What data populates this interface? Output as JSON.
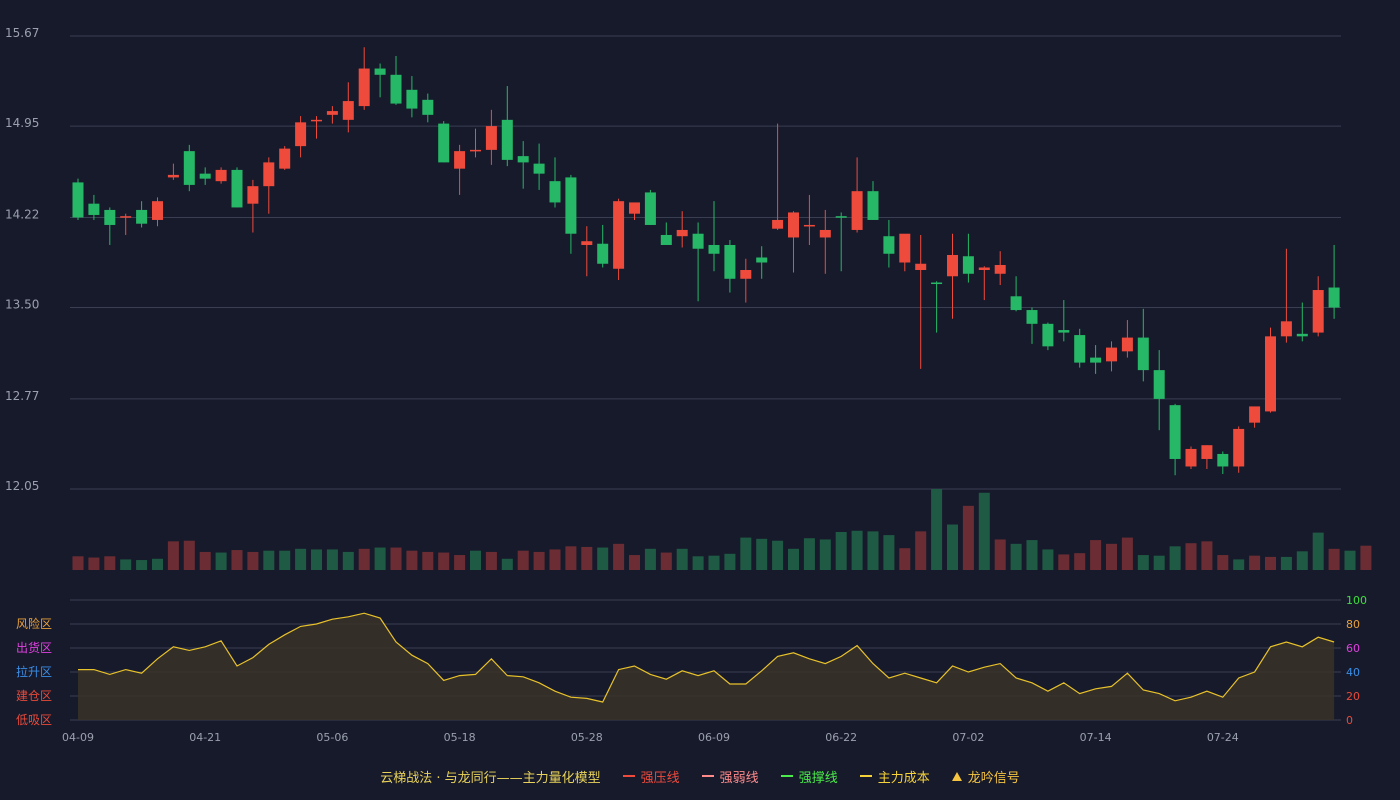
{
  "chart_data": [
    {
      "type": "candlestick",
      "title": "",
      "xlabel": "",
      "ylabel": "",
      "y_ticks": [
        "15.67",
        "14.95",
        "14.22",
        "13.50",
        "12.77",
        "12.05"
      ],
      "ylim": [
        12.05,
        15.67
      ],
      "x_ticks": [
        {
          "label": "04-09",
          "index": 0
        },
        {
          "label": "04-21",
          "index": 8
        },
        {
          "label": "05-06",
          "index": 16
        },
        {
          "label": "05-18",
          "index": 24
        },
        {
          "label": "05-28",
          "index": 32
        },
        {
          "label": "06-09",
          "index": 40
        },
        {
          "label": "06-22",
          "index": 48
        },
        {
          "label": "07-02",
          "index": 56
        },
        {
          "label": "07-14",
          "index": 64
        },
        {
          "label": "07-24",
          "index": 72
        }
      ],
      "colors": {
        "up": "#ee4b3d",
        "down": "#26b866",
        "vol_up": "#6b2d33",
        "vol_down": "#1f5a44"
      },
      "ohlc": [
        [
          14.5,
          14.53,
          14.2,
          14.22
        ],
        [
          14.33,
          14.4,
          14.2,
          14.24
        ],
        [
          14.28,
          14.3,
          14.0,
          14.16
        ],
        [
          14.22,
          14.25,
          14.08,
          14.23
        ],
        [
          14.28,
          14.35,
          14.14,
          14.17
        ],
        [
          14.2,
          14.38,
          14.15,
          14.35
        ],
        [
          14.54,
          14.65,
          14.52,
          14.56
        ],
        [
          14.75,
          14.8,
          14.43,
          14.48
        ],
        [
          14.57,
          14.62,
          14.48,
          14.53
        ],
        [
          14.51,
          14.62,
          14.49,
          14.6
        ],
        [
          14.6,
          14.62,
          14.3,
          14.3
        ],
        [
          14.33,
          14.52,
          14.1,
          14.47
        ],
        [
          14.47,
          14.7,
          14.25,
          14.66
        ],
        [
          14.61,
          14.79,
          14.6,
          14.77
        ],
        [
          14.79,
          15.03,
          14.7,
          14.98
        ],
        [
          14.99,
          15.03,
          14.85,
          15.0
        ],
        [
          15.04,
          15.11,
          14.97,
          15.07
        ],
        [
          15.0,
          15.3,
          14.9,
          15.15
        ],
        [
          15.11,
          15.58,
          15.08,
          15.41
        ],
        [
          15.41,
          15.45,
          15.18,
          15.36
        ],
        [
          15.36,
          15.51,
          15.12,
          15.13
        ],
        [
          15.24,
          15.35,
          15.02,
          15.09
        ],
        [
          15.16,
          15.21,
          14.98,
          15.04
        ],
        [
          14.97,
          14.99,
          14.66,
          14.66
        ],
        [
          14.61,
          14.8,
          14.4,
          14.75
        ],
        [
          14.75,
          14.93,
          14.7,
          14.76
        ],
        [
          14.76,
          15.08,
          14.64,
          14.95
        ],
        [
          15.0,
          15.27,
          14.63,
          14.68
        ],
        [
          14.71,
          14.83,
          14.45,
          14.66
        ],
        [
          14.65,
          14.81,
          14.44,
          14.57
        ],
        [
          14.51,
          14.7,
          14.3,
          14.34
        ],
        [
          14.54,
          14.56,
          13.93,
          14.09
        ],
        [
          14.0,
          14.15,
          13.75,
          14.03
        ],
        [
          14.01,
          14.16,
          13.82,
          13.85
        ],
        [
          13.81,
          14.37,
          13.72,
          14.35
        ],
        [
          14.25,
          14.33,
          14.2,
          14.34
        ],
        [
          14.42,
          14.44,
          14.16,
          14.16
        ],
        [
          14.08,
          14.18,
          14.0,
          14.0
        ],
        [
          14.07,
          14.27,
          13.98,
          14.12
        ],
        [
          14.09,
          14.18,
          13.55,
          13.97
        ],
        [
          14.0,
          14.35,
          13.79,
          13.93
        ],
        [
          14.0,
          14.04,
          13.62,
          13.73
        ],
        [
          13.73,
          13.89,
          13.54,
          13.8
        ],
        [
          13.9,
          13.99,
          13.73,
          13.86
        ],
        [
          14.13,
          14.97,
          14.12,
          14.2
        ],
        [
          14.06,
          14.27,
          13.78,
          14.26
        ],
        [
          14.15,
          14.4,
          14.0,
          14.16
        ],
        [
          14.06,
          14.28,
          13.77,
          14.12
        ],
        [
          14.23,
          14.26,
          13.79,
          14.22
        ],
        [
          14.12,
          14.7,
          14.1,
          14.43
        ],
        [
          14.43,
          14.51,
          14.2,
          14.2
        ],
        [
          14.07,
          14.2,
          13.82,
          13.93
        ],
        [
          13.86,
          14.02,
          13.79,
          14.09
        ],
        [
          13.8,
          14.08,
          13.01,
          13.85
        ],
        [
          13.7,
          13.71,
          13.3,
          13.69
        ],
        [
          13.75,
          14.09,
          13.41,
          13.92
        ],
        [
          13.91,
          14.09,
          13.7,
          13.77
        ],
        [
          13.8,
          13.83,
          13.56,
          13.82
        ],
        [
          13.77,
          13.95,
          13.68,
          13.84
        ],
        [
          13.59,
          13.75,
          13.47,
          13.48
        ],
        [
          13.48,
          13.5,
          13.21,
          13.37
        ],
        [
          13.37,
          13.38,
          13.16,
          13.19
        ],
        [
          13.32,
          13.56,
          13.23,
          13.3
        ],
        [
          13.28,
          13.33,
          13.02,
          13.06
        ],
        [
          13.1,
          13.2,
          12.97,
          13.06
        ],
        [
          13.07,
          13.23,
          12.99,
          13.18
        ],
        [
          13.15,
          13.4,
          13.1,
          13.26
        ],
        [
          13.26,
          13.49,
          12.91,
          13.0
        ],
        [
          13.0,
          13.16,
          12.52,
          12.77
        ],
        [
          12.72,
          12.73,
          12.16,
          12.29
        ],
        [
          12.23,
          12.39,
          12.21,
          12.37
        ],
        [
          12.29,
          12.4,
          12.21,
          12.4
        ],
        [
          12.33,
          12.35,
          12.17,
          12.23
        ],
        [
          12.23,
          12.55,
          12.18,
          12.53
        ],
        [
          12.58,
          12.68,
          12.54,
          12.71
        ],
        [
          12.67,
          13.34,
          12.66,
          13.27
        ],
        [
          13.27,
          13.97,
          13.22,
          13.39
        ],
        [
          13.29,
          13.54,
          13.23,
          13.27
        ],
        [
          13.3,
          13.75,
          13.27,
          13.64
        ],
        [
          13.66,
          14.0,
          13.41,
          13.5
        ]
      ],
      "volume": [
        22,
        20,
        22,
        17,
        16,
        18,
        46,
        47,
        29,
        28,
        32,
        29,
        31,
        31,
        34,
        33,
        33,
        29,
        34,
        36,
        36,
        31,
        29,
        28,
        24,
        31,
        29,
        18,
        31,
        29,
        33,
        38,
        37,
        36,
        42,
        24,
        34,
        28,
        34,
        22,
        23,
        26,
        52,
        50,
        47,
        34,
        51,
        49,
        61,
        63,
        62,
        56,
        35,
        62,
        130,
        73,
        103,
        124,
        49,
        42,
        48,
        33,
        25,
        27,
        48,
        42,
        52,
        24,
        23,
        38,
        43,
        46,
        24,
        17,
        23,
        21,
        21,
        30,
        60,
        34,
        31,
        39
      ],
      "volume_up": [
        true,
        true,
        true,
        false,
        false,
        false,
        true,
        true,
        true,
        false,
        true,
        true,
        false,
        false,
        false,
        false,
        false,
        false,
        true,
        false,
        true,
        true,
        true,
        true,
        true,
        false,
        true,
        false,
        true,
        true,
        true,
        true,
        true,
        false,
        true,
        true,
        false,
        true,
        false,
        false,
        false,
        false,
        false,
        false,
        false,
        false,
        false,
        false,
        false,
        false,
        false,
        false,
        true,
        true,
        false,
        false,
        true,
        false,
        true,
        false,
        false,
        false,
        true,
        true,
        true,
        true,
        true,
        false,
        false,
        false,
        true,
        true,
        true,
        false,
        true,
        true,
        false,
        false,
        false,
        true,
        false,
        true
      ]
    },
    {
      "type": "area",
      "title": "",
      "ylim": [
        0,
        100
      ],
      "y_ticks": [
        {
          "value": 100,
          "label": "100",
          "color": "#3de03d"
        },
        {
          "value": 80,
          "label": "80",
          "color": "#e8a13a"
        },
        {
          "value": 60,
          "label": "60",
          "color": "#e040e0"
        },
        {
          "value": 40,
          "label": "40",
          "color": "#3a8ee8"
        },
        {
          "value": 20,
          "label": "20",
          "color": "#e84a3a"
        },
        {
          "value": 0,
          "label": "0",
          "color": "#e84a3a"
        }
      ],
      "zones": [
        {
          "label": "风险区",
          "value": 80,
          "color": "#e8a13a"
        },
        {
          "label": "出货区",
          "value": 60,
          "color": "#e040e0"
        },
        {
          "label": "拉升区",
          "value": 40,
          "color": "#3a8ee8"
        },
        {
          "label": "建仓区",
          "value": 20,
          "color": "#e84a3a"
        },
        {
          "label": "低吸区",
          "value": 0,
          "color": "#e84a3a"
        }
      ],
      "line_color": "#e8c22a",
      "values": [
        42,
        42,
        38,
        42,
        39,
        51,
        61,
        58,
        61,
        66,
        45,
        52,
        63,
        71,
        78,
        80,
        84,
        86,
        89,
        85,
        65,
        54,
        47,
        33,
        37,
        38,
        51,
        37,
        36,
        31,
        24,
        19,
        18,
        15,
        42,
        45,
        38,
        34,
        41,
        37,
        41,
        30,
        30,
        41,
        53,
        56,
        51,
        47,
        53,
        62,
        47,
        35,
        39,
        35,
        31,
        45,
        40,
        44,
        47,
        35,
        31,
        24,
        31,
        22,
        26,
        28,
        39,
        25,
        22,
        16,
        19,
        24,
        19,
        35,
        40,
        61,
        65,
        61,
        69,
        65
      ]
    }
  ],
  "legend": {
    "title": "云梯战法 · 与龙同行——主力量化模型",
    "title_color": "#e8d25a",
    "items": [
      {
        "label": "强压线",
        "style": "solid",
        "color": "#ee4b3d"
      },
      {
        "label": "强弱线",
        "style": "dash",
        "color": "#ff8a8a"
      },
      {
        "label": "强撑线",
        "style": "solid",
        "color": "#4aeb4a"
      },
      {
        "label": "主力成本",
        "style": "dash",
        "color": "#f5d23a"
      },
      {
        "label": "龙吟信号",
        "style": "triangle",
        "color": "#f5c542"
      }
    ]
  }
}
